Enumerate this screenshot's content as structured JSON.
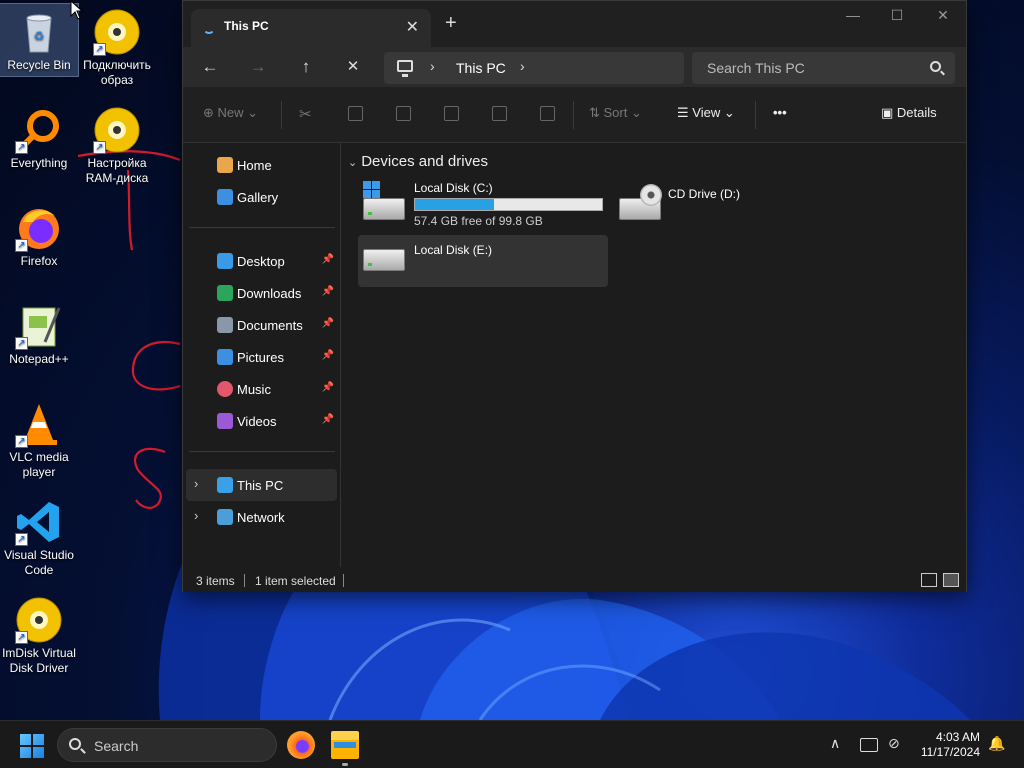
{
  "desktop": {
    "icons": [
      {
        "label": "Recycle Bin",
        "icon": "recycle-bin-icon"
      },
      {
        "label": "Подключить образ",
        "icon": "disc-image-icon"
      },
      {
        "label": "Everything",
        "icon": "magnifier-icon"
      },
      {
        "label": "Настройка RAM-диска",
        "icon": "disc-image-icon"
      },
      {
        "label": "Firefox",
        "icon": "firefox-icon"
      },
      {
        "label": "Notepad++",
        "icon": "notepadpp-icon"
      },
      {
        "label": "VLC media player",
        "icon": "vlc-cone-icon"
      },
      {
        "label": "Visual Studio Code",
        "icon": "vscode-icon"
      },
      {
        "label": "ImDisk Virtual Disk Driver",
        "icon": "disc-image-icon"
      }
    ]
  },
  "window": {
    "tab_title": "This PC",
    "new_tab": "+",
    "close_tab": "✕",
    "controls": {
      "minimize": "—",
      "maximize": "☐",
      "close": "✕"
    },
    "nav": {
      "back": "←",
      "forward": "→",
      "up": "↑",
      "stop": "✕"
    },
    "address": {
      "crumb": "This PC",
      "chevron": "›"
    },
    "search_placeholder": "Search This PC",
    "commands": {
      "new": "New",
      "sort": "Sort",
      "view": "View",
      "more": "•••",
      "details": "Details"
    },
    "nav_pane": {
      "top": [
        {
          "label": "Home",
          "icon": "home-icon"
        },
        {
          "label": "Gallery",
          "icon": "gallery-icon"
        }
      ],
      "quick": [
        {
          "label": "Desktop",
          "icon": "desktop-folder-icon",
          "pin": "📌"
        },
        {
          "label": "Downloads",
          "icon": "download-icon",
          "pin": "📌"
        },
        {
          "label": "Documents",
          "icon": "documents-icon",
          "pin": "📌"
        },
        {
          "label": "Pictures",
          "icon": "pictures-icon",
          "pin": "📌"
        },
        {
          "label": "Music",
          "icon": "music-icon",
          "pin": "📌"
        },
        {
          "label": "Videos",
          "icon": "videos-icon",
          "pin": "📌"
        }
      ],
      "tree": [
        {
          "label": "This PC",
          "icon": "this-pc-icon",
          "expand": "›"
        },
        {
          "label": "Network",
          "icon": "network-icon",
          "expand": "›"
        }
      ]
    },
    "content": {
      "group": "Devices and drives",
      "group_caret": "⌄",
      "drives": [
        {
          "name": "Local Disk (C:)",
          "free_text": "57.4 GB free of 99.8 GB",
          "used_fraction": 0.425
        },
        {
          "name": "CD Drive (D:)"
        },
        {
          "name": "Local Disk (E:)"
        }
      ]
    },
    "status": {
      "count": "3 items",
      "selected": "1 item selected"
    }
  },
  "taskbar": {
    "search_label": "Search",
    "clock_time": "4:03 AM",
    "clock_date": "11/17/2024",
    "tray": {
      "chevron": "∧",
      "bell": "🔔"
    }
  },
  "colors": {
    "accent": "#27a0e4",
    "window_bg": "#1c1c1c",
    "annotation_red": "#d41b2c"
  }
}
